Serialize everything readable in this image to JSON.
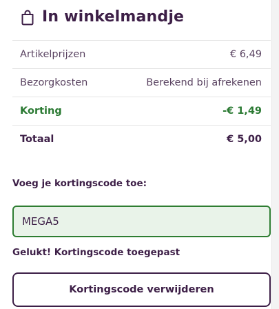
{
  "header": {
    "icon": "shopping-bag-icon",
    "title": "In winkelmandje"
  },
  "summary": {
    "rows": [
      {
        "label": "Artikelprijzen",
        "value": "€ 6,49"
      },
      {
        "label": "Bezorgkosten",
        "value": "Berekend bij afrekenen"
      },
      {
        "label": "Korting",
        "value": "-€ 1,49"
      },
      {
        "label": "Totaal",
        "value": "€ 5,00"
      }
    ]
  },
  "coupon": {
    "label": "Voeg je kortingscode toe:",
    "value": "MEGA5",
    "success_message": "Gelukt! Kortingscode toegepast",
    "remove_button": "Kortingscode verwijderen"
  },
  "colors": {
    "primary": "#3d1f47",
    "discount_green": "#2b7a33",
    "input_border": "#2e7d32",
    "input_background": "#e9f3e9"
  }
}
